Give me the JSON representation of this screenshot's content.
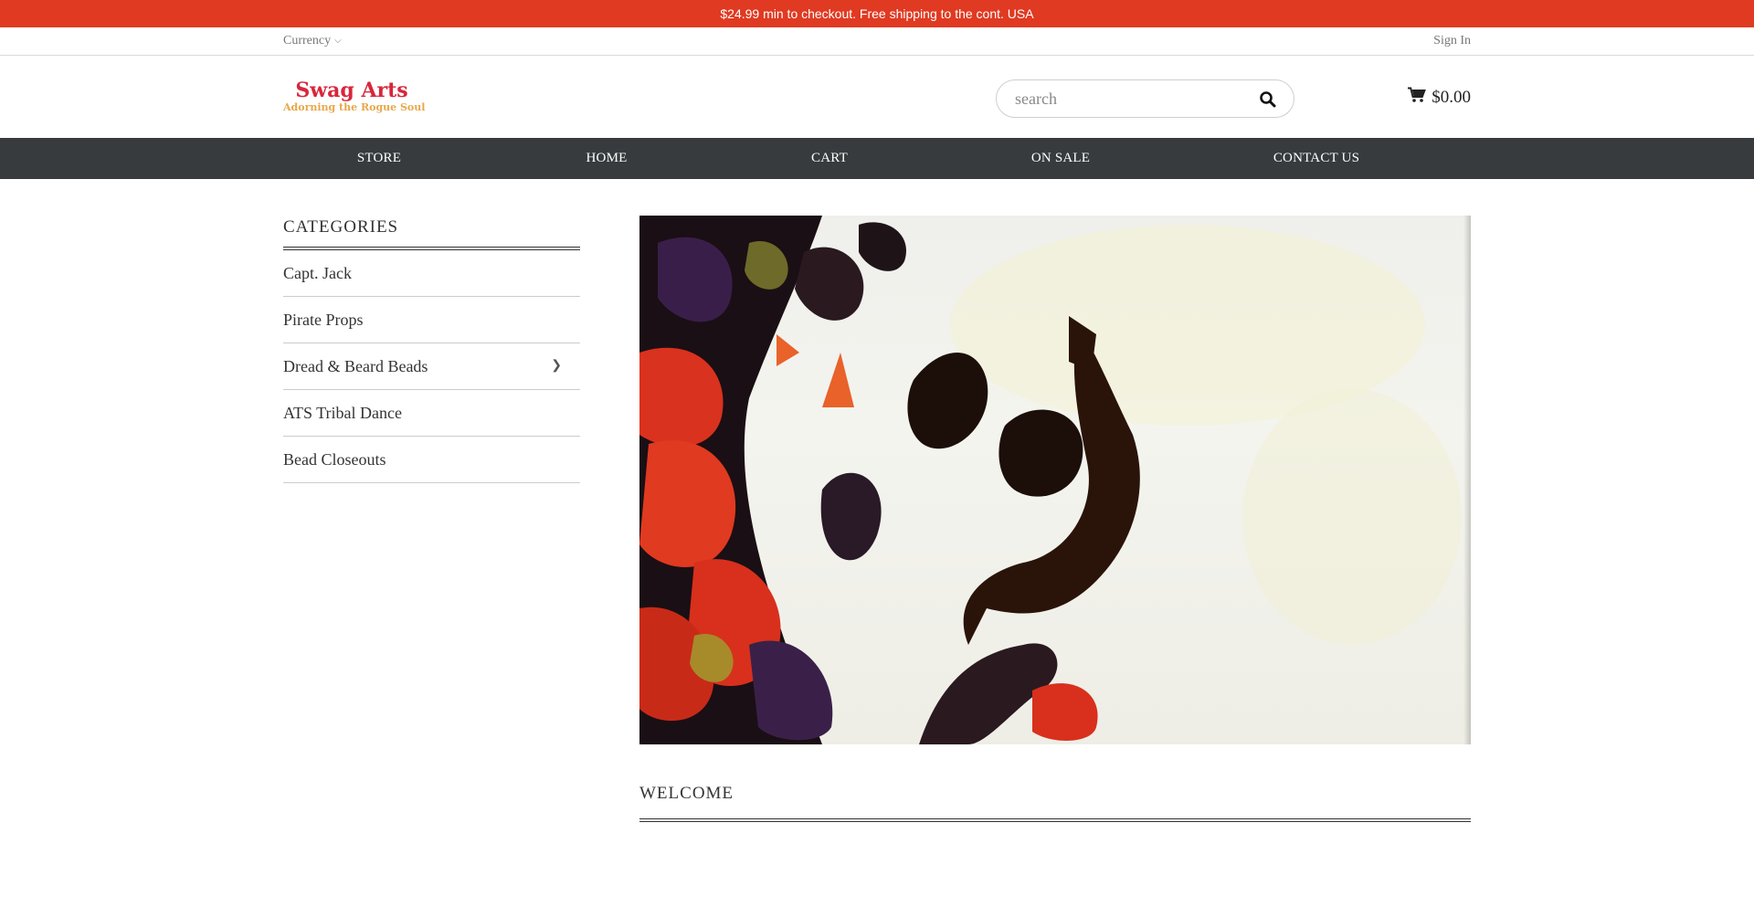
{
  "promo": {
    "text": "$24.99 min to checkout. Free shipping to the cont. USA"
  },
  "utility": {
    "currency_label": "Currency",
    "signin_label": "Sign In"
  },
  "header": {
    "logo_title": "Swag Arts",
    "logo_tagline": "Adorning the Rogue Soul",
    "search_placeholder": "search",
    "cart_total": "$0.00"
  },
  "nav": {
    "items": [
      {
        "label": "STORE"
      },
      {
        "label": "HOME"
      },
      {
        "label": "CART"
      },
      {
        "label": "ON SALE"
      },
      {
        "label": "CONTACT US"
      }
    ]
  },
  "sidebar": {
    "heading": "CATEGORIES",
    "items": [
      {
        "label": "Capt. Jack"
      },
      {
        "label": "Pirate Props"
      },
      {
        "label": "Dread & Beard Beads"
      },
      {
        "label": "ATS Tribal Dance"
      },
      {
        "label": "Bead Closeouts"
      }
    ]
  },
  "main": {
    "welcome_heading": "WELCOME"
  },
  "icons": {
    "search": "search-icon",
    "cart": "cart-icon",
    "currency_chevron": "chevron-down-icon",
    "category_chevron": "chevron-right-icon"
  },
  "colors": {
    "promo_bg": "#e03a22",
    "nav_bg": "#373b3d",
    "logo_red": "#d8263c",
    "logo_gold": "#e8a84a"
  }
}
